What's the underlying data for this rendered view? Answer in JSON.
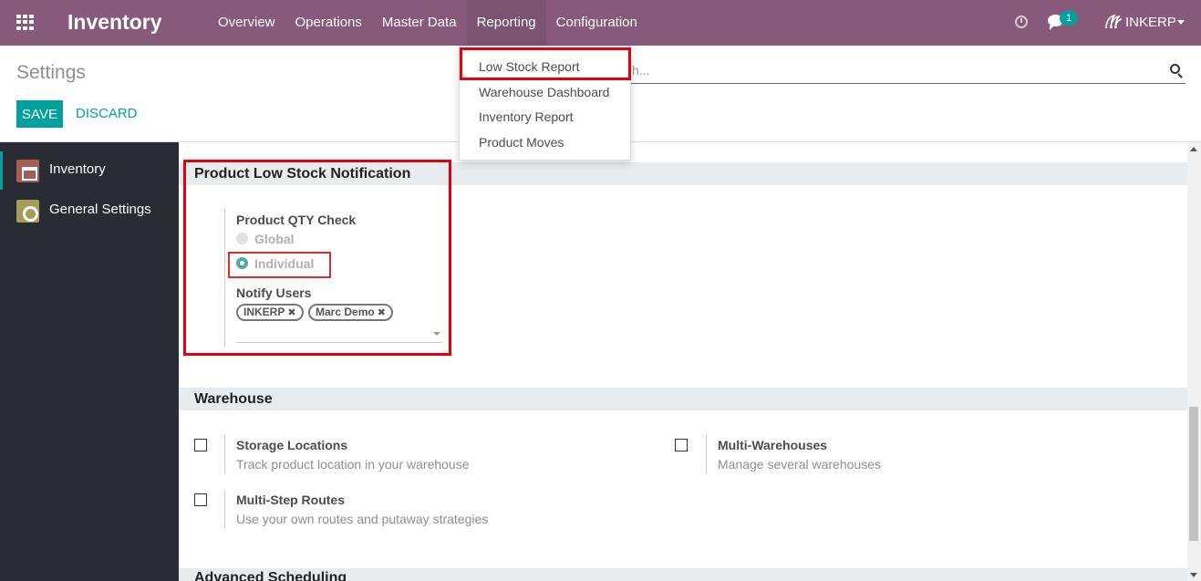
{
  "navbar": {
    "brand": "Inventory",
    "menu": [
      "Overview",
      "Operations",
      "Master Data",
      "Reporting",
      "Configuration"
    ],
    "active_menu": "Reporting",
    "notification_count": "1",
    "user": "INKERP",
    "color": "#875a7b"
  },
  "reporting_menu": {
    "items": [
      "Low Stock Report",
      "Warehouse Dashboard",
      "Inventory Report",
      "Product Moves"
    ],
    "highlighted": "Low Stock Report"
  },
  "control_panel": {
    "title": "Settings",
    "save_label": "SAVE",
    "discard_label": "DISCARD",
    "search_placeholder": "h..."
  },
  "sidebar": {
    "items": [
      {
        "label": "Inventory",
        "icon": "inventory-app-icon",
        "active": true
      },
      {
        "label": "General Settings",
        "icon": "gear-icon",
        "active": false
      }
    ]
  },
  "sections": {
    "low_stock": {
      "title": "Product Low Stock Notification",
      "qty_check_label": "Product QTY Check",
      "options": [
        "Global",
        "Individual"
      ],
      "selected_option": "Individual",
      "notify_label": "Notify Users",
      "users": [
        "INKERP",
        "Marc Demo"
      ]
    },
    "warehouse": {
      "title": "Warehouse",
      "settings": [
        {
          "title": "Storage Locations",
          "desc": "Track product location in your warehouse",
          "checked": false
        },
        {
          "title": "Multi-Warehouses",
          "desc": "Manage several warehouses",
          "checked": false
        },
        {
          "title": "Multi-Step Routes",
          "desc": "Use your own routes and putaway strategies",
          "checked": false
        }
      ]
    },
    "advanced": {
      "title": "Advanced Scheduling"
    }
  },
  "colors": {
    "accent": "#00a09d",
    "highlight": "#e3000f"
  }
}
